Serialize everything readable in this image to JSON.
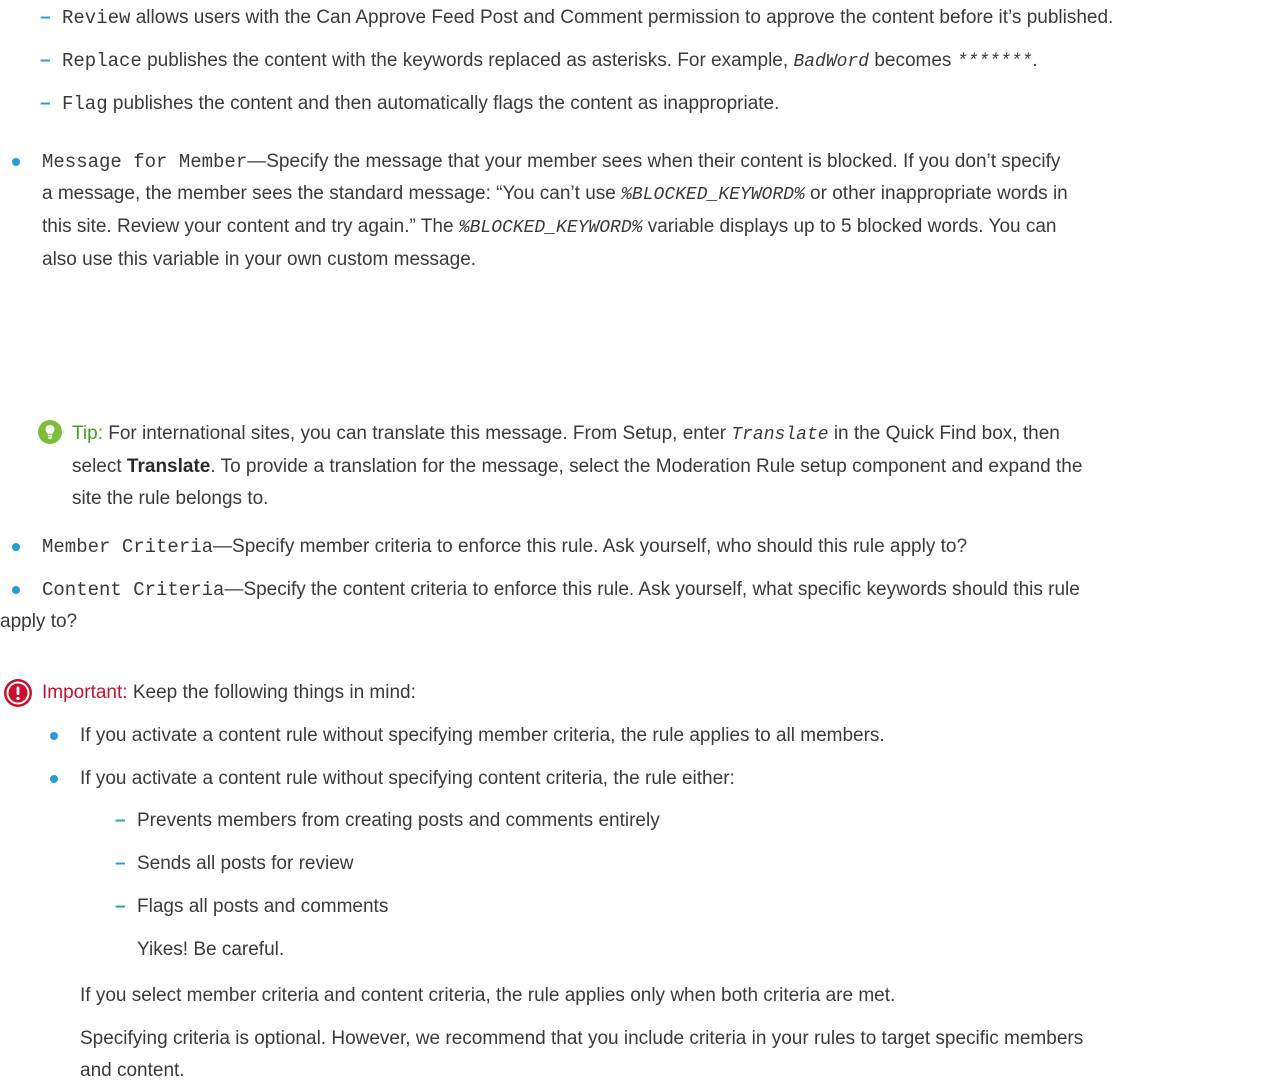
{
  "accent_color": "#2a9ad6",
  "tip_color": "#4c9a2a",
  "important_color": "#c8102e",
  "actions": [
    {
      "code": "Review",
      "text": " allows users with the Can Approve Feed Post and Comment permission to approve the content before it’s published."
    },
    {
      "code": "Replace",
      "text_before": " publishes the content with the keywords replaced as asterisks. For example, ",
      "example_word": "BadWord",
      "text_mid": " becomes ",
      "example_stars": "*******",
      "text_after": "."
    },
    {
      "code": "Flag",
      "text": " publishes the content and then automatically flags the content as inappropriate."
    }
  ],
  "message_for_member": {
    "code": "Message for Member",
    "line1": "—Specify the message that your member sees when their content is blocked. If you don’t specify",
    "line2_a": "a message, the member sees the standard message: “You can’t use ",
    "var": "%BLOCKED_KEYWORD%",
    "line2_b": " or other inappropriate words in",
    "line3_a": "this site. Review your content and try again.” The ",
    "line3_b": " variable displays up to 5 blocked words. You can",
    "line4": "also use this variable in your own custom message."
  },
  "tip": {
    "icon": "lightbulb-icon",
    "label": "Tip:",
    "line1_a": " For international sites, you can translate this message. From Setup, enter ",
    "code": "Translate",
    "line1_b": " in the Quick Find box, then",
    "line2_a": "select ",
    "bold": "Translate",
    "line2_b": ". To provide a translation for the message, select the Moderation Rule setup component and expand the",
    "line3": "site the rule belongs to."
  },
  "member_criteria": {
    "code": "Member Criteria",
    "text": "—Specify member criteria to enforce this rule. Ask yourself, who should this rule apply to?"
  },
  "content_criteria": {
    "code": "Content Criteria",
    "line1": "—Specify the content criteria to enforce this rule. Ask yourself, what specific keywords should this rule",
    "line2": "apply to?"
  },
  "important": {
    "icon": "exclamation-icon",
    "label": "Important:",
    "text": " Keep the following things in mind:",
    "items": [
      "If you activate a content rule without specifying member criteria, the rule applies to all members.",
      "If you activate a content rule without specifying content criteria, the rule either:"
    ],
    "subitems": [
      "Prevents members from creating posts and comments entirely",
      "Sends all posts for review",
      "Flags all posts and comments"
    ],
    "yikes": "Yikes! Be careful.",
    "item3": "If you select member criteria and content criteria, the rule applies only when both criteria are met.",
    "item4_line1": "Specifying criteria is optional. However, we recommend that you include criteria in your rules to target specific members",
    "item4_line2": "and content."
  }
}
